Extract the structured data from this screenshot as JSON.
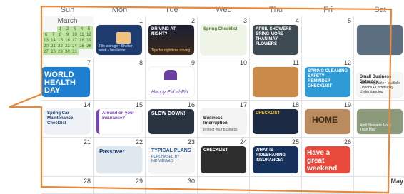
{
  "weekdays": [
    "Sun",
    "Mon",
    "Tue",
    "Wed",
    "Thu",
    "Fri",
    "Sat"
  ],
  "mini_calendar": {
    "month": "March",
    "days": [
      "1",
      "2",
      "3",
      "4",
      "5",
      "6",
      "7",
      "8",
      "9",
      "10",
      "11",
      "12",
      "13",
      "14",
      "15",
      "16",
      "17",
      "18",
      "19",
      "20",
      "21",
      "22",
      "23",
      "24",
      "25",
      "26",
      "27",
      "28",
      "29",
      "30",
      "31"
    ],
    "highlighted": [
      "1",
      "2",
      "3",
      "4",
      "5",
      "6",
      "7",
      "8",
      "9",
      "10",
      "11",
      "12",
      "13",
      "14",
      "15",
      "16",
      "17",
      "18",
      "19",
      "20",
      "21",
      "22",
      "23",
      "24",
      "25",
      "26",
      "27",
      "28",
      "29",
      "30",
      "31"
    ]
  },
  "days": {
    "d1": {
      "num": "1",
      "title": "",
      "sub": "File storage • Shelter work • Insulation"
    },
    "d2": {
      "num": "2",
      "title": "DRIVING AT NIGHT?",
      "sub": "Tips for nighttime driving"
    },
    "d3": {
      "num": "3",
      "title": "Spring Checklist",
      "sub": ""
    },
    "d4": {
      "num": "4",
      "title": "APRIL SHOWERS BRING MORE THAN MAY FLOWERS",
      "sub": ""
    },
    "d5": {
      "num": "5",
      "title": "",
      "sub": ""
    },
    "d6": {
      "num": "",
      "title": "Small Business Saturday",
      "sub": "Knowledgeable • Multiple Options • Community Understanding"
    },
    "d7": {
      "num": "7",
      "title": "WORLD HEALTH DAY",
      "sub": ""
    },
    "d8": {
      "num": "8",
      "title": "",
      "sub": ""
    },
    "d9": {
      "num": "9",
      "title": "Happy Eid al-Fitr",
      "sub": ""
    },
    "d10": {
      "num": "10",
      "title": "",
      "sub": ""
    },
    "d11": {
      "num": "11",
      "title": "",
      "sub": ""
    },
    "d12": {
      "num": "12",
      "title": "SPRING CLEANING SAFETY REMINDER CHECKLIST",
      "sub": ""
    },
    "d13": {
      "num": "",
      "title": "",
      "sub": ""
    },
    "d14": {
      "num": "14",
      "title": "Spring Car Maintenance Checklist",
      "sub": ""
    },
    "d15": {
      "num": "15",
      "title": "Around on your insurance?",
      "sub": ""
    },
    "d16": {
      "num": "16",
      "title": "SLOW DOWN!",
      "sub": ""
    },
    "d17": {
      "num": "17",
      "title": "Business Interruption",
      "sub": "protect your business"
    },
    "d18": {
      "num": "18",
      "title": "CHECKLIST",
      "sub": ""
    },
    "d19": {
      "num": "19",
      "title": "HOME",
      "sub": ""
    },
    "d20": {
      "num": "",
      "title": "April Showers More Than May",
      "sub": ""
    },
    "d21": {
      "num": "21",
      "title": "",
      "sub": ""
    },
    "d22": {
      "num": "22",
      "title": "Passover",
      "sub": ""
    },
    "d23": {
      "num": "23",
      "title": "TYPICAL PLANS",
      "sub": "PURCHASED BY INDIVIDUALS"
    },
    "d24": {
      "num": "24",
      "title": "CHECKLIST",
      "sub": ""
    },
    "d25": {
      "num": "25",
      "title": "WHAT IS RIDESHARING INSURANCE?",
      "sub": ""
    },
    "d26": {
      "num": "26",
      "title": "Have a great weekend",
      "sub": ""
    },
    "d27": {
      "num": "",
      "title": "",
      "sub": ""
    },
    "d28": {
      "num": "28",
      "title": "",
      "sub": ""
    },
    "d29": {
      "num": "29",
      "title": "",
      "sub": ""
    },
    "d30": {
      "num": "30",
      "title": "",
      "sub": ""
    },
    "d31": {
      "num": "",
      "title": "",
      "sub": ""
    },
    "d32": {
      "num": "",
      "title": "",
      "sub": ""
    },
    "d33": {
      "num": "",
      "title": "",
      "sub": ""
    },
    "d34": {
      "num": "May",
      "title": "",
      "sub": ""
    }
  },
  "colors": {
    "outline": "#e8893a",
    "highlight": "#bfe3a0"
  }
}
